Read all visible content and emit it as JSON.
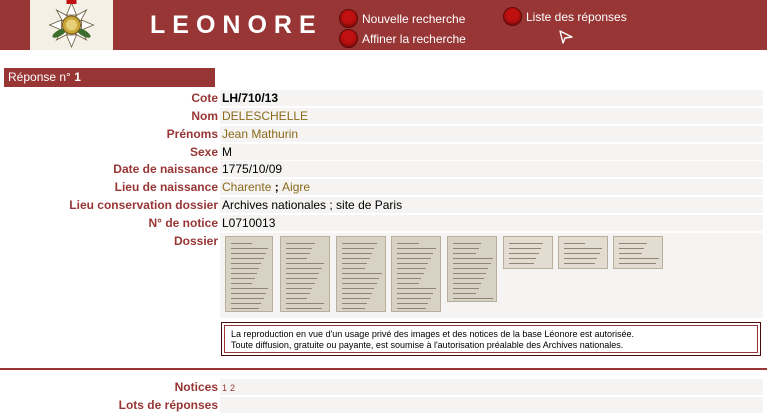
{
  "header": {
    "title": "LEONORE",
    "nav": {
      "nouvelle": "Nouvelle recherche",
      "affiner": "Affiner la recherche",
      "liste": "Liste des réponses"
    }
  },
  "response": {
    "prefix": "Réponse n°",
    "number": "1"
  },
  "fields": {
    "cote": {
      "label": "Cote",
      "value": "LH/710/13"
    },
    "nom": {
      "label": "Nom",
      "value": "DELESCHELLE"
    },
    "prenoms": {
      "label": "Prénoms",
      "value": "Jean Mathurin"
    },
    "sexe": {
      "label": "Sexe",
      "value": "M"
    },
    "date_naissance": {
      "label": "Date de naissance",
      "value": "1775/10/09"
    },
    "lieu_naissance": {
      "label": "Lieu de naissance",
      "value1": "Charente",
      "sep": " ; ",
      "value2": "Aigre"
    },
    "lieu_conservation": {
      "label": "Lieu conservation dossier",
      "value": "Archives nationales ; site de Paris"
    },
    "notice": {
      "label": "N° de notice",
      "value": "L0710013"
    },
    "dossier": {
      "label": "Dossier"
    }
  },
  "notice_text": {
    "line1": "La reproduction en vue d'un usage privé des images et des notices de la base Léonore est autorisée.",
    "line2": "Toute diffusion, gratuite ou payante, est soumise à l'autorisation préalable des Archives nationales."
  },
  "bottom": {
    "notices_label": "Notices",
    "pages": [
      "1",
      "2"
    ],
    "lots_label": "Lots de réponses"
  },
  "colors": {
    "brand": "#983535",
    "link": "#8a6a1a"
  },
  "icons": {
    "logo": "legion-honneur-medal",
    "nav_button": "red-round-button-icon",
    "arrow": "arrow-icon"
  }
}
